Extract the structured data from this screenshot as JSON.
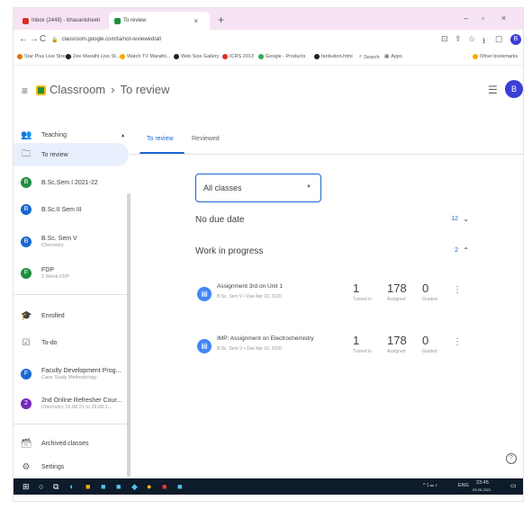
{
  "browser": {
    "tabs": [
      {
        "label": "Inbox (2449) - bhavanisheeti",
        "active": false,
        "color": "#d93025"
      },
      {
        "label": "To review",
        "active": true,
        "color": "#1e8e3e"
      }
    ],
    "new_tab": "+",
    "url": "classroom.google.com/ta/not-reviewed/all",
    "bookmarks": [
      {
        "label": "Star Plus Live Strea...",
        "color": "#e37400"
      },
      {
        "label": "Zee Marathi Live St...",
        "color": "#202124"
      },
      {
        "label": "Watch TV Marathi...",
        "color": "#f9ab00"
      },
      {
        "label": "Web Size Gallery",
        "color": "#202124"
      },
      {
        "label": "ICRS 2013",
        "color": "#d93025"
      },
      {
        "label": "Google - Products",
        "color": "#34a853"
      },
      {
        "label": "faribution.html",
        "color": "#202124"
      },
      {
        "label": "Search",
        "color": "#5f6368"
      },
      {
        "label": "Apps",
        "color": "#5f6368"
      },
      {
        "label": "Other bookmarks",
        "color": "#f9ab00"
      }
    ],
    "profile_initial": "B"
  },
  "header": {
    "app_name": "Classroom",
    "separator": "›",
    "page": "To review",
    "avatar_initial": "B"
  },
  "sidebar": {
    "teaching": "Teaching",
    "to_review": "To review",
    "classes": [
      {
        "initial": "B",
        "label": "B.Sc.Sem I 2021-22",
        "sub": "",
        "color": "#1e8e3e"
      },
      {
        "initial": "B",
        "label": "B.Sc.II Sem III",
        "sub": "",
        "color": "#1967d2"
      },
      {
        "initial": "B",
        "label": "B.Sc. Sem V",
        "sub": "Chemistry",
        "color": "#1967d2"
      },
      {
        "initial": "F",
        "label": "FDP",
        "sub": "2 Week FDP",
        "color": "#1e8e3e"
      }
    ],
    "enrolled": "Enrolled",
    "todo": "To-do",
    "enrolled_classes": [
      {
        "initial": "F",
        "label": "Faculty Development Prog...",
        "sub": "Case Study Methodology",
        "color": "#1967d2"
      },
      {
        "initial": "2",
        "label": "2nd Online Refresher Cour...",
        "sub": "Chemistry 16.08.21 to 29.08.2...",
        "color": "#7627bb"
      }
    ],
    "archived": "Archived classes",
    "settings": "Settings"
  },
  "main": {
    "tabs": {
      "to_review": "To review",
      "reviewed": "Reviewed"
    },
    "filter": {
      "selected": "All classes"
    },
    "no_due_date": {
      "label": "No due date",
      "count": "12"
    },
    "work_in_progress": {
      "label": "Work in progress",
      "count": "2"
    },
    "assignments": [
      {
        "title": "Assignment 3rd on Unit 1",
        "meta": "B.Sc. Sem V • Due Apr 23, 2020",
        "turned_in": "1",
        "turned_in_label": "Turned in",
        "assigned": "178",
        "assigned_label": "Assigned",
        "graded": "0",
        "graded_label": "Graded"
      },
      {
        "title": "IMP: Assignment on Electrochemistry",
        "meta": "B.Sc. Sem V • Due Apr 16, 2020",
        "turned_in": "1",
        "turned_in_label": "Turned in",
        "assigned": "178",
        "assigned_label": "Assigned",
        "graded": "0",
        "graded_label": "Graded"
      }
    ]
  },
  "taskbar": {
    "lang": "ENG",
    "time": "23:45",
    "date": "05-08-2021"
  },
  "colors": {
    "accent": "#1967d2",
    "taskbar": "#0d1b2a"
  }
}
